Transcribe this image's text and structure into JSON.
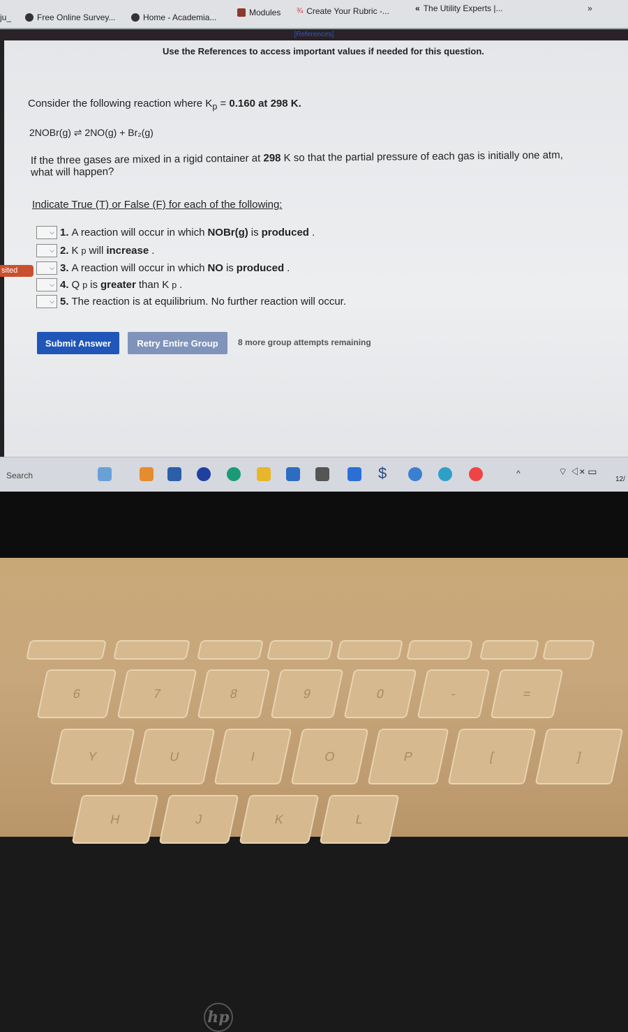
{
  "bookmarks": [
    {
      "label": "ju_"
    },
    {
      "label": "Free Online Survey..."
    },
    {
      "label": "Home - Academia..."
    },
    {
      "label": "Modules"
    },
    {
      "label": "Create Your Rubric -..."
    },
    {
      "label": "The Utility Experts |..."
    },
    {
      "label": "»"
    }
  ],
  "references_link": "[References]",
  "references_note": "Use the References to access important values if needed for this question.",
  "question": {
    "intro_prefix": "Consider the following reaction where K",
    "intro_sub": "p",
    "intro_eq": " = ",
    "intro_value": "0.160 at 298 K.",
    "reaction": "2NOBr(g) ⇌ 2NO(g) + Br₂(g)",
    "body_prefix": "If the three gases are mixed in a rigid container at ",
    "body_temp": "298",
    "body_suffix": " K so that the partial pressure of each gas is initially one atm,",
    "body_line2": "what will happen?",
    "instruction": "Indicate True (T) or False (F) for each of the following:"
  },
  "items": [
    {
      "n": "1.",
      "a": " A reaction will occur in which ",
      "b": "NOBr(g)",
      "c": " is ",
      "d": "produced",
      "e": "."
    },
    {
      "n": "2.",
      "a": " K",
      "sub": "p",
      "c": " will ",
      "d": "increase",
      "e": "."
    },
    {
      "n": "3.",
      "a": " A reaction will occur in which ",
      "b": "NO",
      "c": " is ",
      "d": "produced",
      "e": "."
    },
    {
      "n": "4.",
      "a": " Q",
      "sub": "p",
      "c": " is ",
      "d": "greater",
      "e": " than K",
      "sub2": "p",
      "f": "."
    },
    {
      "n": "5.",
      "a": " The reaction is at equilibrium. No further reaction will occur."
    }
  ],
  "buttons": {
    "submit": "Submit Answer",
    "retry": "Retry Entire Group",
    "attempts": "8 more group attempts remaining"
  },
  "sidebar_badge": "sited",
  "taskbar": {
    "search": "Search",
    "clock": "12/"
  },
  "colors": {
    "submit": "#1f56b8",
    "retry": "#7f93bb",
    "badge": "#c9502e",
    "link": "#2e56c8"
  }
}
